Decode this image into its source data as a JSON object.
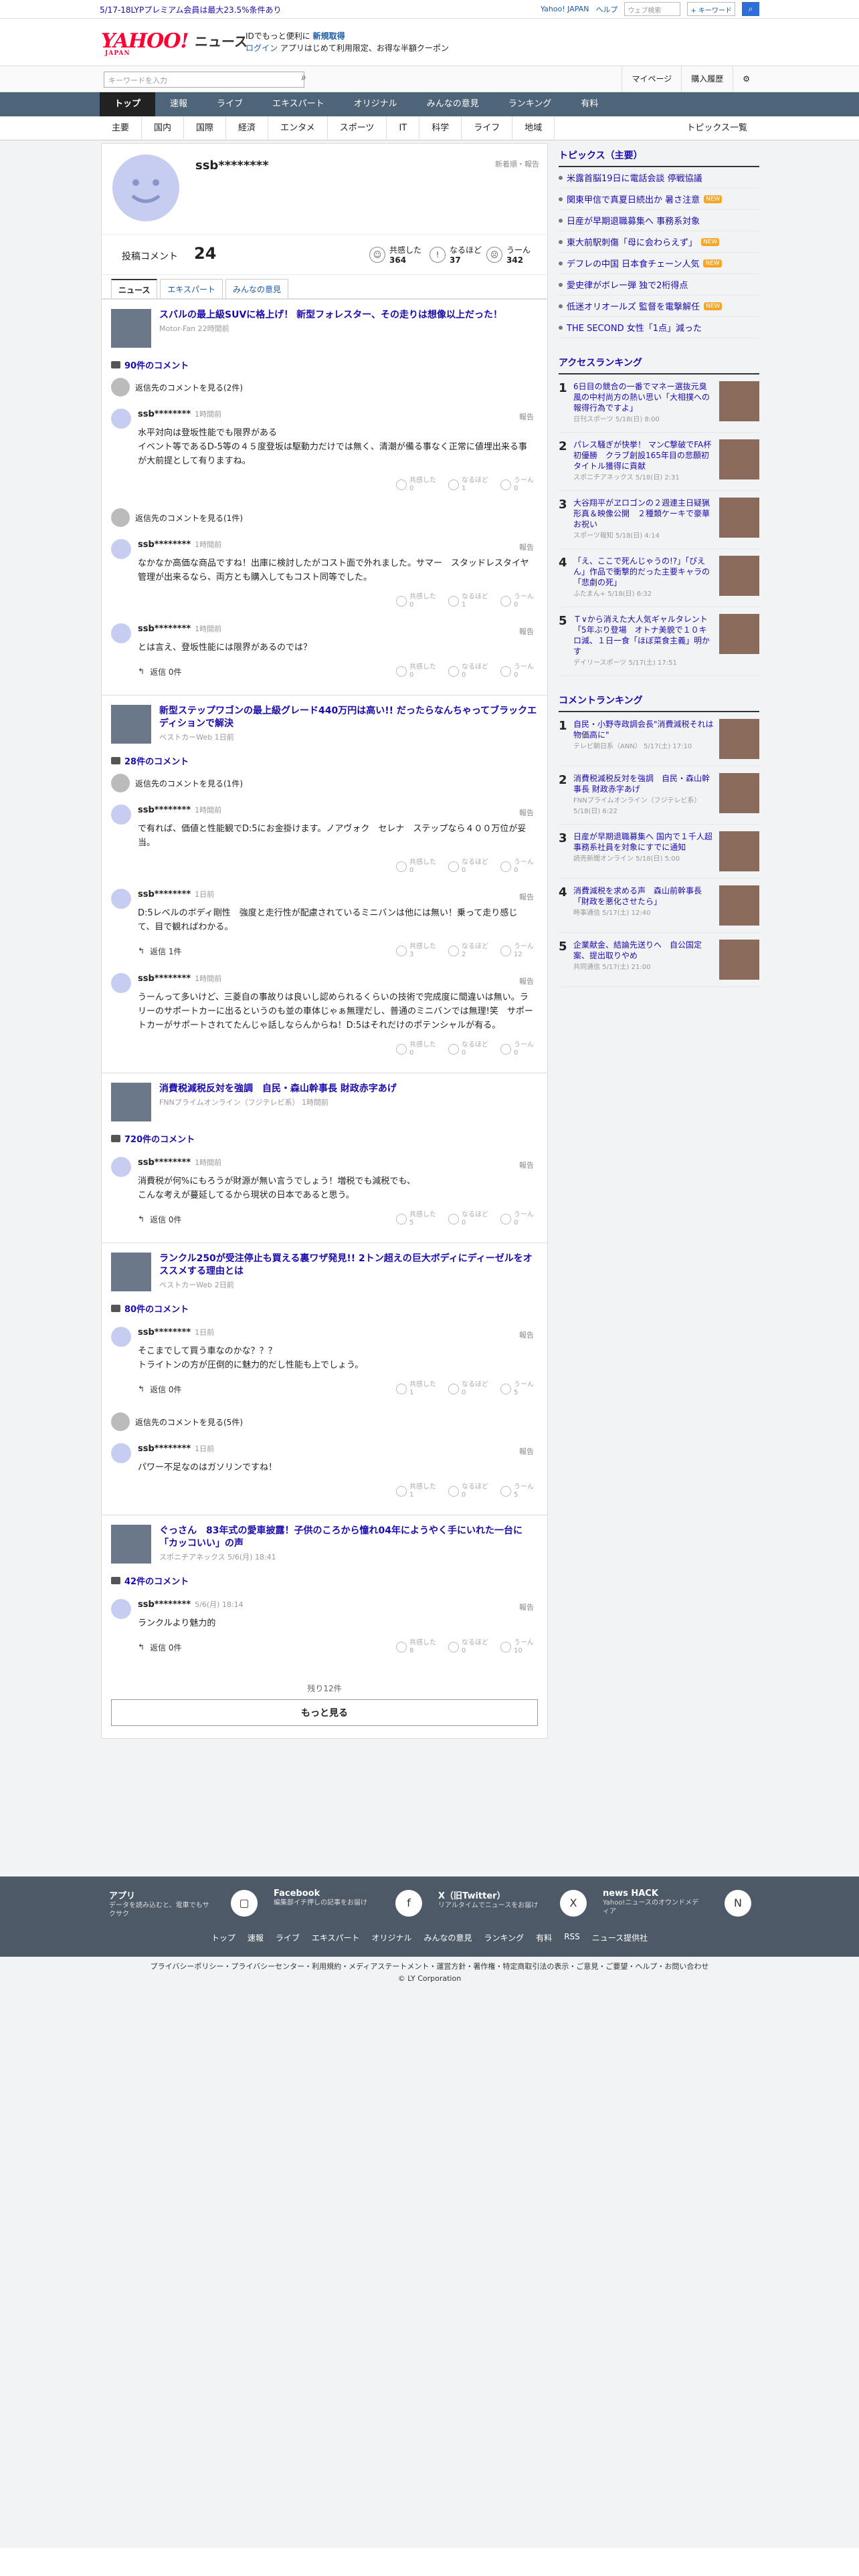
{
  "topbar": {
    "promo": "5/17-18LYPプレミアム会員は最大23.5%条件あり",
    "links": [
      "Yahoo! JAPAN",
      "ヘルプ"
    ],
    "search_placeholder": "ウェブ検索",
    "scope": "+ キーワード"
  },
  "header": {
    "logo": "YAHOO!",
    "logo_sub": "JAPAN",
    "section": "ニュース",
    "tag1": "IDでもっと便利に",
    "tag1b": "新規取得",
    "tag2a": "ログイン",
    "tag2b": "アプリはじめて利用限定、お得な半額クーポン"
  },
  "search": {
    "placeholder": "キーワードを入力",
    "links": [
      "マイページ",
      "購入履歴"
    ]
  },
  "mainnav": [
    "トップ",
    "速報",
    "ライブ",
    "エキスパート",
    "オリジナル",
    "みんなの意見",
    "ランキング",
    "有料"
  ],
  "subnav": [
    "主要",
    "国内",
    "国際",
    "経済",
    "エンタメ",
    "スポーツ",
    "IT",
    "科学",
    "ライフ",
    "地域"
  ],
  "subnav_all": "トピックス一覧",
  "profile": {
    "name": "ssb********",
    "newest": "新着順・報告",
    "count_label": "投稿コメント",
    "count": "24",
    "reactions": [
      {
        "label": "共感した",
        "value": "364"
      },
      {
        "label": "なるほど",
        "value": "37"
      },
      {
        "label": "うーん",
        "value": "342"
      }
    ]
  },
  "tabs": [
    "ニュース",
    "エキスパート",
    "みんなの意見"
  ],
  "articles": [
    {
      "title": "スバルの最上級SUVに格上げ！ 新型フォレスター、その走りは想像以上だった！",
      "source": "Motor-Fan 22時間前",
      "count": "90件のコメント",
      "prev": "返信先のコメントを見る(2件)",
      "comments": [
        {
          "user": "ssb********",
          "time": "1時間前",
          "text": "水平対向は登坂性能でも限界がある\nイベント等であるD-5等の４５度登坂は駆動力だけでは無く、清潮が備る事なく正常に値埋出来る事が大前提として有りますね。",
          "v": [
            "0",
            "1",
            "0"
          ],
          "reply": ""
        },
        {
          "prev": "返信先のコメントを見る(1件)",
          "user": "ssb********",
          "time": "1時間前",
          "text": "なかなか高価な商品ですね！出庫に検討したがコスト面で外れました。サマー　スタッドレスタイヤ管理が出来るなら、両方とも購入してもコスト同等でした。",
          "v": [
            "0",
            "1",
            "0"
          ],
          "reply": ""
        },
        {
          "user": "ssb********",
          "time": "1時間前",
          "text": "とは言え、登坂性能には限界があるのでは？",
          "v": [
            "0",
            "0",
            "0"
          ],
          "reply": "返信 0件"
        }
      ]
    },
    {
      "title": "新型ステップワゴンの最上級グレード440万円は高い!! だったらなんちゃってブラックエディションで解決",
      "source": "ベストカーWeb 1日前",
      "count": "28件のコメント",
      "prev": "返信先のコメントを見る(1件)",
      "comments": [
        {
          "user": "ssb********",
          "time": "1時間前",
          "text": "で有れば、価値と性能観でD:5にお金掛けます。ノアヴォク　セレナ　ステップなら４００万位が妥当。",
          "v": [
            "0",
            "0",
            "0"
          ],
          "reply": ""
        },
        {
          "user": "ssb********",
          "time": "1日前",
          "text": "D:5レベルのボディ剛性　強度と走行性が配慮されているミニバンは他には無い！乗って走り感じて、目で観ればわかる。",
          "v": [
            "3",
            "2",
            "12"
          ],
          "reply": "返信 1件"
        },
        {
          "user": "ssb********",
          "time": "1時間前",
          "text": "うーんって多いけど、三菱自の事故りは良いし認められるくらいの技術で完成度に間違いは無い。ラリーのサポートカーに出るというのも並の車体じゃぁ無理だし、普通のミニバンでは無理!笑　サポートカーがサポートされてたんじゃ話しならんからね！D:5はそれだけのポテンシャルが有る。",
          "v": [
            "0",
            "0",
            "0"
          ],
          "reply": ""
        }
      ]
    },
    {
      "title": "消費税減税反対を強調　自民・森山幹事長 財政赤字あげ",
      "source": "FNNプライムオンライン（フジテレビ系） 1時間前",
      "count": "720件のコメント",
      "prev": "",
      "comments": [
        {
          "user": "ssb********",
          "time": "1時間前",
          "text": "消費税が何%にもろうが財源が無い言うでしょう！増税でも減税でも、\nこんな考えが蔓延してるから現状の日本であると思う。",
          "v": [
            "5",
            "0",
            "0"
          ],
          "reply": "返信 0件"
        }
      ]
    },
    {
      "title": "ランクル250が受注停止も買える裏ワザ発見!! 2トン超えの巨大ボディにディーゼルをオススメする理由とは",
      "source": "ベストカーWeb 2日前",
      "count": "80件のコメント",
      "prev": "",
      "comments": [
        {
          "user": "ssb********",
          "time": "1日前",
          "text": "そこまでして買う車なのかな？？？\nトライトンの方が圧倒的に魅力的だし性能も上でしょう。",
          "v": [
            "1",
            "0",
            "5"
          ],
          "reply": "返信 0件"
        },
        {
          "prev": "返信先のコメントを見る(5件)",
          "user": "ssb********",
          "time": "1日前",
          "text": "パワー不足なのはガソリンですね！",
          "v": [
            "1",
            "0",
            "5"
          ],
          "reply": ""
        }
      ]
    },
    {
      "title": "ぐっさん　83年式の愛車披露！子供のころから憧れ04年にようやく手にいれた一台に「カッコいい」の声",
      "source": "スポニチアネックス 5/6(月) 18:41",
      "count": "42件のコメント",
      "prev": "",
      "comments": [
        {
          "user": "ssb********",
          "time": "5/6(月) 18:14",
          "text": "ランクルより魅力的",
          "v": [
            "8",
            "0",
            "10"
          ],
          "reply": "返信 0件"
        }
      ]
    }
  ],
  "vote_labels": [
    "共感した",
    "なるほど",
    "うーん"
  ],
  "report": "報告",
  "remaining": "残り12件",
  "more": "もっと見る",
  "right": {
    "topics_title": "トピックス（主要）",
    "topics": [
      {
        "t": "米露首脳19日に電話会談 停戦協議",
        "n": false
      },
      {
        "t": "関東甲信で真夏日続出か 暑さ注意",
        "n": true
      },
      {
        "t": "日産が早期退職募集へ 事務系対象",
        "n": false
      },
      {
        "t": "東大前駅刺傷「母に会わらえず」",
        "n": true
      },
      {
        "t": "デフレの中国 日本食チェーン人気",
        "n": true
      },
      {
        "t": "愛史律がボレー弾 独で2桁得点",
        "n": false
      },
      {
        "t": "低迷オリオールズ 監督を電撃解任",
        "n": true
      },
      {
        "t": "THE SECOND 女性「1点」減った",
        "n": false
      }
    ],
    "access_title": "アクセスランキング",
    "access": [
      {
        "t": "6日目の競合の一番でマネー選抜元臭風の中村尚方の熱い思い「大相撲への報得行為ですよ」",
        "s": "日刊スポーツ 5/18(日) 8:00"
      },
      {
        "t": "パレス騒ぎが快挙！ マンC撃破でFA杯初優勝　クラブ創設165年目の悲願初タイトル獲得に貢献",
        "s": "スポニチアネックス 5/18(日) 2:31"
      },
      {
        "t": "大谷翔平がヱロゴンの２週連主日疑猟形真＆映像公開　２種類ケーキで豪華お祝い",
        "s": "スポーツ報知 5/18(日) 4:14"
      },
      {
        "t": "「え、ここで死んじゃうの!?」「ぴえん」作品で衝撃的だった主要キャラの「悲劇の死」",
        "s": "ふたまん+ 5/18(日) 6:32"
      },
      {
        "t": "Ｔ∨から消えた大人気ギャルタレント「5年ぶり登場　オトナ美貌で１０キロ減、１日一食「ほぼ菜食主義」明かす",
        "s": "デイリースポーツ 5/17(土) 17:51"
      }
    ],
    "comment_title": "コメントランキング",
    "comments": [
      {
        "t": "自民・小野寺政調会長\"消費減税それは物価高に\"",
        "s": "テレビ朝日系（ANN） 5/17(土) 17:10"
      },
      {
        "t": "消費税減税反対を強調　自民・森山幹事長 財政赤字あげ",
        "s": "FNNプライムオンライン（フジテレビ系） 5/18(日) 6:22"
      },
      {
        "t": "日産が早期退職募集へ 国内で１千人超　事務系社員を対象にすでに通知",
        "s": "読売新聞オンライン 5/18(日) 5:00"
      },
      {
        "t": "消費減税を求める声　森山前幹事長「財政を悪化させたら」",
        "s": "時事通信 5/17(土) 12:40"
      },
      {
        "t": "企業献金、結論先送りへ　自公国定案、提出取りやめ",
        "s": "共同通信 5/17(土) 21:00"
      }
    ]
  },
  "footer": {
    "items": [
      {
        "t": "アプリ",
        "d": "データを読み込むと、電車でもサクサク"
      },
      {
        "t": "Facebook",
        "d": "編集部イチ押しの記事をお届け"
      },
      {
        "t": "X（旧Twitter）",
        "d": "リアルタイムでニュースをお届け"
      },
      {
        "t": "news HACK",
        "d": "Yahoo!ニュースのオウンドメディア"
      }
    ],
    "links": [
      "トップ",
      "速報",
      "ライブ",
      "エキスパート",
      "オリジナル",
      "みんなの意見",
      "ランキング",
      "有料",
      "RSS",
      "ニュース提供社"
    ]
  },
  "legal": "プライバシーポリシー・プライバシーセンター・利用規約・メディアステートメント・運営方針・著作権・特定商取引法の表示・ご意見・ご要望・ヘルプ・お問い合わせ",
  "copyright": "© LY Corporation",
  "colors": {
    "nav": "#4d6479",
    "link": "#1a0dab",
    "brand": "#ff0033"
  }
}
